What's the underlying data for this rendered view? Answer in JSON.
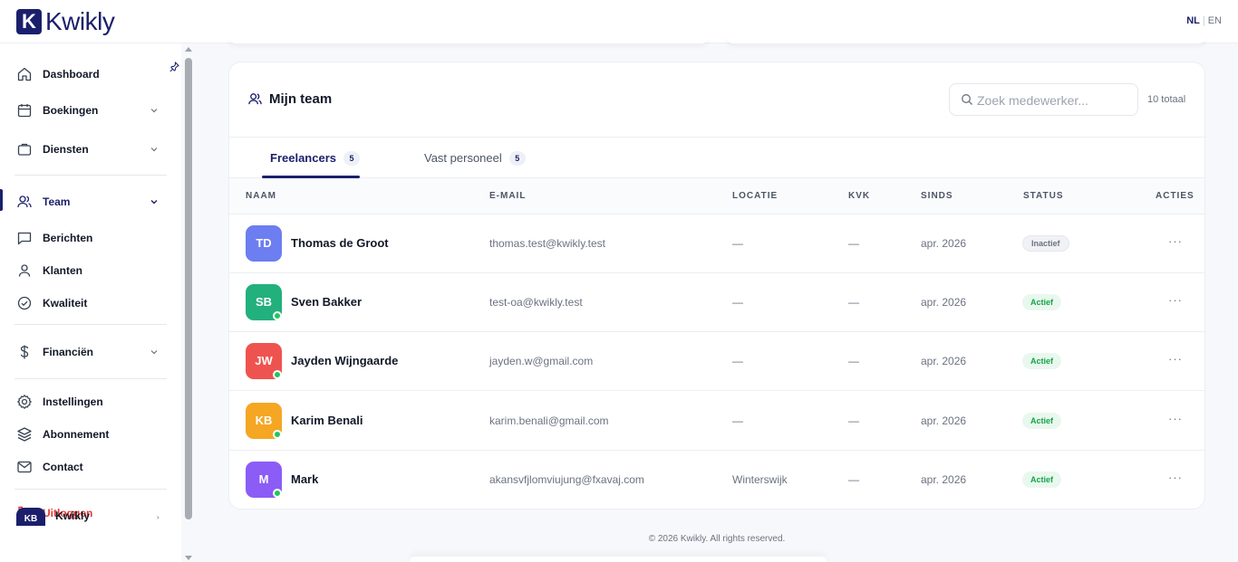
{
  "brand": {
    "logo_mark": "K",
    "logo_text": "Kwikly"
  },
  "lang": {
    "active": "NL",
    "separator": "|",
    "other": "EN"
  },
  "sidebar": {
    "items": [
      {
        "label": "Dashboard",
        "icon": "home-icon"
      },
      {
        "label": "Boekingen",
        "icon": "calendar-icon",
        "has_chevron": true
      },
      {
        "label": "Diensten",
        "icon": "briefcase-icon",
        "has_chevron": true
      },
      {
        "label": "Team",
        "icon": "users-icon",
        "has_chevron": true,
        "active": true
      },
      {
        "label": "Berichten",
        "icon": "message-icon"
      },
      {
        "label": "Klanten",
        "icon": "user-icon"
      },
      {
        "label": "Kwaliteit",
        "icon": "check-circle-icon"
      },
      {
        "label": "Financiën",
        "icon": "dollar-icon",
        "has_chevron": true
      },
      {
        "label": "Instellingen",
        "icon": "gear-icon"
      },
      {
        "label": "Abonnement",
        "icon": "layers-icon"
      },
      {
        "label": "Contact",
        "icon": "mail-icon"
      },
      {
        "label": "Uitloggen",
        "icon": "logout-icon"
      }
    ],
    "profile": {
      "initials": "KB",
      "name": "Kwikly"
    }
  },
  "team": {
    "title": "Mijn team",
    "search_placeholder": "Zoek medewerker...",
    "total": "10 totaal",
    "tabs": [
      {
        "label": "Freelancers",
        "count": "5",
        "active": true
      },
      {
        "label": "Vast personeel",
        "count": "5",
        "active": false
      }
    ],
    "columns": [
      "NAAM",
      "E-MAIL",
      "LOCATIE",
      "KVK",
      "SINDS",
      "STATUS",
      "ACTIES"
    ],
    "rows": [
      {
        "initials": "TD",
        "name": "Thomas de Groot",
        "email": "thomas.test@kwikly.test",
        "location": "—",
        "kvk": "—",
        "since": "apr. 2026",
        "status": "Inactief",
        "online": false,
        "color": "#6c7ef0"
      },
      {
        "initials": "SB",
        "name": "Sven Bakker",
        "email": "test-oa@kwikly.test",
        "location": "—",
        "kvk": "—",
        "since": "apr. 2026",
        "status": "Actief",
        "online": true,
        "color": "#22b07d"
      },
      {
        "initials": "JW",
        "name": "Jayden Wijngaarde",
        "email": "jayden.w@gmail.com",
        "location": "—",
        "kvk": "—",
        "since": "apr. 2026",
        "status": "Actief",
        "online": true,
        "color": "#ef5350"
      },
      {
        "initials": "KB",
        "name": "Karim Benali",
        "email": "karim.benali@gmail.com",
        "location": "—",
        "kvk": "—",
        "since": "apr. 2026",
        "status": "Actief",
        "online": true,
        "color": "#f5a623"
      },
      {
        "initials": "M",
        "name": "Mark",
        "email": "akansvfjlomviujung@fxavaj.com",
        "location": "Winterswijk",
        "kvk": "—",
        "since": "apr. 2026",
        "status": "Actief",
        "online": true,
        "color": "#8b5cf6"
      }
    ],
    "actions_label": "···"
  },
  "footer": {
    "text": "© 2026 Kwikly. All rights reserved."
  },
  "colors": {
    "brand": "#1b1f6b",
    "danger": "#e53935",
    "success": "#16a34a",
    "online": "#22c55e"
  }
}
